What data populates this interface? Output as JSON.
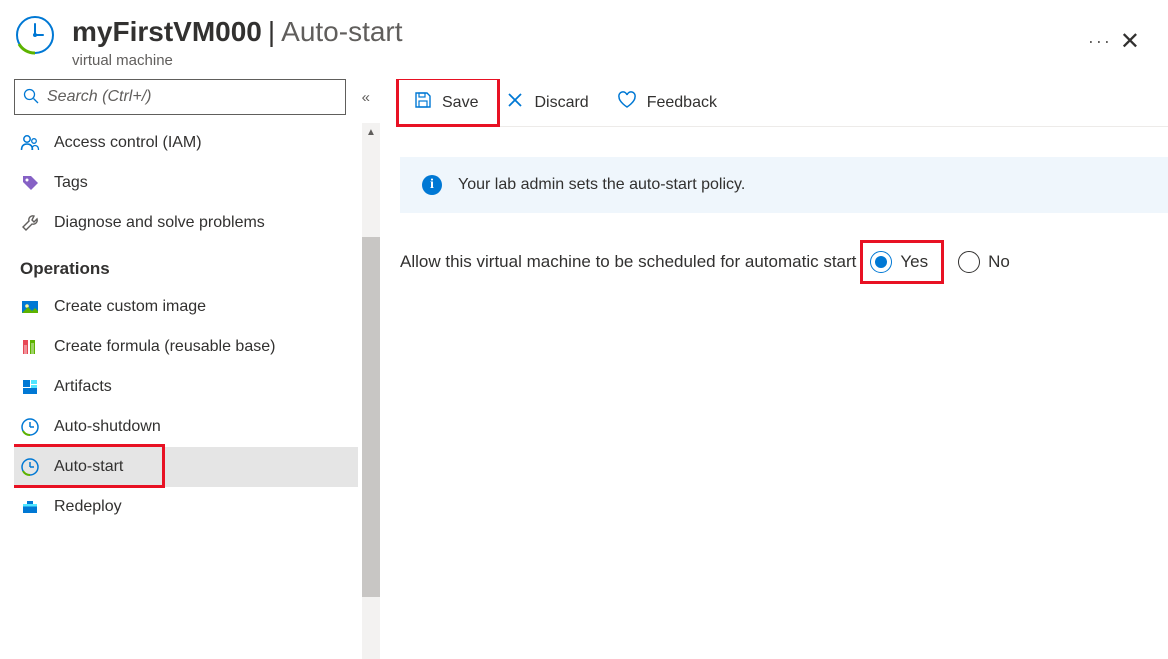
{
  "header": {
    "resource_name": "myFirstVM000",
    "page_name": "Auto-start",
    "subtitle": "virtual machine"
  },
  "sidebar": {
    "search_placeholder": "Search (Ctrl+/)",
    "items_top": [
      {
        "label": "Access control (IAM)",
        "icon": "people-icon"
      },
      {
        "label": "Tags",
        "icon": "tag-icon"
      },
      {
        "label": "Diagnose and solve problems",
        "icon": "wrench-icon"
      }
    ],
    "section_operations": "Operations",
    "items_ops": [
      {
        "label": "Create custom image",
        "icon": "image-icon"
      },
      {
        "label": "Create formula (reusable base)",
        "icon": "formula-icon"
      },
      {
        "label": "Artifacts",
        "icon": "artifacts-icon"
      },
      {
        "label": "Auto-shutdown",
        "icon": "clock-icon"
      },
      {
        "label": "Auto-start",
        "icon": "clock-icon",
        "selected": true,
        "highlight": true
      },
      {
        "label": "Redeploy",
        "icon": "redeploy-icon"
      }
    ]
  },
  "toolbar": {
    "save_label": "Save",
    "discard_label": "Discard",
    "feedback_label": "Feedback"
  },
  "content": {
    "info_message": "Your lab admin sets the auto-start policy.",
    "setting_label": "Allow this virtual machine to be scheduled for automatic start",
    "radio_yes": "Yes",
    "radio_no": "No",
    "selected_value": "Yes"
  }
}
